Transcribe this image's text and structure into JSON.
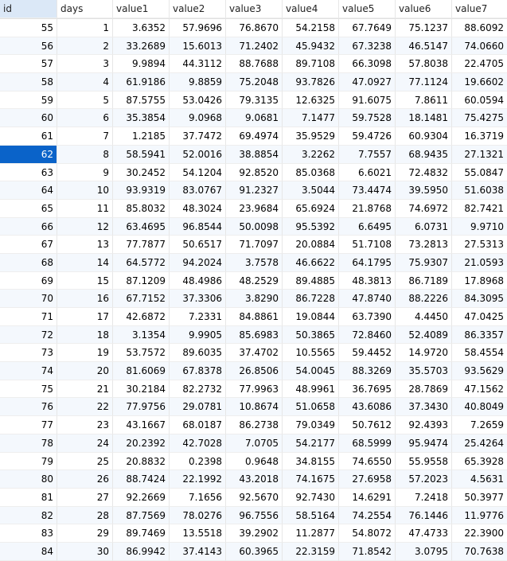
{
  "columns": [
    "id",
    "days",
    "value1",
    "value2",
    "value3",
    "value4",
    "value5",
    "value6",
    "value7"
  ],
  "selected_id": 62,
  "rows": [
    [
      "55",
      "1",
      "3.6352",
      "57.9696",
      "76.8670",
      "54.2158",
      "67.7649",
      "75.1237",
      "88.6092"
    ],
    [
      "56",
      "2",
      "33.2689",
      "15.6013",
      "71.2402",
      "45.9432",
      "67.3238",
      "46.5147",
      "74.0660"
    ],
    [
      "57",
      "3",
      "9.9894",
      "44.3112",
      "88.7688",
      "89.7108",
      "66.3098",
      "57.8038",
      "22.4705"
    ],
    [
      "58",
      "4",
      "61.9186",
      "9.8859",
      "75.2048",
      "93.7826",
      "47.0927",
      "77.1124",
      "19.6602"
    ],
    [
      "59",
      "5",
      "87.5755",
      "53.0426",
      "79.3135",
      "12.6325",
      "91.6075",
      "7.8611",
      "60.0594"
    ],
    [
      "60",
      "6",
      "35.3854",
      "9.0968",
      "9.0681",
      "7.1477",
      "59.7528",
      "18.1481",
      "75.4275"
    ],
    [
      "61",
      "7",
      "1.2185",
      "37.7472",
      "69.4974",
      "35.9529",
      "59.4726",
      "60.9304",
      "16.3719"
    ],
    [
      "62",
      "8",
      "58.5941",
      "52.0016",
      "38.8854",
      "3.2262",
      "7.7557",
      "68.9435",
      "27.1321"
    ],
    [
      "63",
      "9",
      "30.2452",
      "54.1204",
      "92.8520",
      "85.0368",
      "6.6021",
      "72.4832",
      "55.0847"
    ],
    [
      "64",
      "10",
      "93.9319",
      "83.0767",
      "91.2327",
      "3.5044",
      "73.4474",
      "39.5950",
      "51.6038"
    ],
    [
      "65",
      "11",
      "85.8032",
      "48.3024",
      "23.9684",
      "65.6924",
      "21.8768",
      "74.6972",
      "82.7421"
    ],
    [
      "66",
      "12",
      "63.4695",
      "96.8544",
      "50.0098",
      "95.5392",
      "6.6495",
      "6.0731",
      "9.9710"
    ],
    [
      "67",
      "13",
      "77.7877",
      "50.6517",
      "71.7097",
      "20.0884",
      "51.7108",
      "73.2813",
      "27.5313"
    ],
    [
      "68",
      "14",
      "64.5772",
      "94.2024",
      "3.7578",
      "46.6622",
      "64.1795",
      "75.9307",
      "21.0593"
    ],
    [
      "69",
      "15",
      "87.1209",
      "48.4986",
      "48.2529",
      "89.4885",
      "48.3813",
      "86.7189",
      "17.8968"
    ],
    [
      "70",
      "16",
      "67.7152",
      "37.3306",
      "3.8290",
      "86.7228",
      "47.8740",
      "88.2226",
      "84.3095"
    ],
    [
      "71",
      "17",
      "42.6872",
      "7.2331",
      "84.8861",
      "19.0844",
      "63.7390",
      "4.4450",
      "47.0425"
    ],
    [
      "72",
      "18",
      "3.1354",
      "9.9905",
      "85.6983",
      "50.3865",
      "72.8460",
      "52.4089",
      "86.3357"
    ],
    [
      "73",
      "19",
      "53.7572",
      "89.6035",
      "37.4702",
      "10.5565",
      "59.4452",
      "14.9720",
      "58.4554"
    ],
    [
      "74",
      "20",
      "81.6069",
      "67.8378",
      "26.8506",
      "54.0045",
      "88.3269",
      "35.5703",
      "93.5629"
    ],
    [
      "75",
      "21",
      "30.2184",
      "82.2732",
      "77.9963",
      "48.9961",
      "36.7695",
      "28.7869",
      "47.1562"
    ],
    [
      "76",
      "22",
      "77.9756",
      "29.0781",
      "10.8674",
      "51.0658",
      "43.6086",
      "37.3430",
      "40.8049"
    ],
    [
      "77",
      "23",
      "43.1667",
      "68.0187",
      "86.2738",
      "79.0349",
      "50.7612",
      "92.4393",
      "7.2659"
    ],
    [
      "78",
      "24",
      "20.2392",
      "42.7028",
      "7.0705",
      "54.2177",
      "68.5999",
      "95.9474",
      "25.4264"
    ],
    [
      "79",
      "25",
      "20.8832",
      "0.2398",
      "0.9648",
      "34.8155",
      "74.6550",
      "55.9558",
      "65.3928"
    ],
    [
      "80",
      "26",
      "88.7424",
      "22.1992",
      "43.2018",
      "74.1675",
      "27.6958",
      "57.2023",
      "4.5631"
    ],
    [
      "81",
      "27",
      "92.2669",
      "7.1656",
      "92.5670",
      "92.7430",
      "14.6291",
      "7.2418",
      "50.3977"
    ],
    [
      "82",
      "28",
      "87.7569",
      "78.0276",
      "96.7556",
      "58.5164",
      "74.2554",
      "76.1446",
      "11.9776"
    ],
    [
      "83",
      "29",
      "89.7469",
      "13.5518",
      "39.2902",
      "11.2877",
      "54.8072",
      "47.4733",
      "22.3900"
    ],
    [
      "84",
      "30",
      "86.9942",
      "37.4143",
      "60.3965",
      "22.3159",
      "71.8542",
      "3.0795",
      "70.7638"
    ]
  ]
}
